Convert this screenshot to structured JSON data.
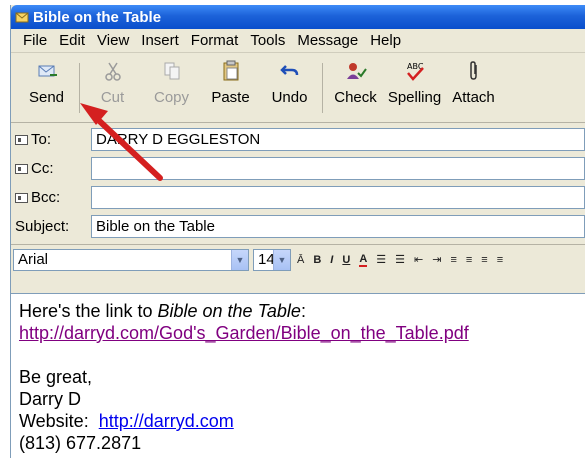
{
  "window": {
    "title": "Bible on the Table"
  },
  "menu": [
    "File",
    "Edit",
    "View",
    "Insert",
    "Format",
    "Tools",
    "Message",
    "Help"
  ],
  "toolbar": [
    {
      "label": "Send",
      "icon": "send-icon",
      "enabled": true
    },
    {
      "label": "Cut",
      "icon": "scissors-icon",
      "enabled": false
    },
    {
      "label": "Copy",
      "icon": "copy-icon",
      "enabled": false
    },
    {
      "label": "Paste",
      "icon": "paste-icon",
      "enabled": true
    },
    {
      "label": "Undo",
      "icon": "undo-icon",
      "enabled": true
    },
    {
      "label": "Check",
      "icon": "check-names-icon",
      "enabled": true
    },
    {
      "label": "Spelling",
      "icon": "spelling-icon",
      "enabled": true
    },
    {
      "label": "Attach",
      "icon": "paperclip-icon",
      "enabled": true
    }
  ],
  "header": {
    "to_label": "To:",
    "to_value": "DARRY D EGGLESTON",
    "cc_label": "Cc:",
    "cc_value": "",
    "bcc_label": "Bcc:",
    "bcc_value": "",
    "subject_label": "Subject:",
    "subject_value": "Bible on the Table"
  },
  "format": {
    "font": "Arial",
    "size": "14"
  },
  "body": {
    "intro_prefix": "Here's the link to ",
    "intro_title": "Bible on the Table",
    "intro_suffix": ":",
    "link1": "http://darryd.com/God's_Garden/Bible_on_the_Table.pdf",
    "sign1": "Be great,",
    "sign2": "Darry D",
    "website_label": "Website:  ",
    "website_link": "http://darryd.com",
    "phone": "(813) 677.2871"
  },
  "colors": {
    "title_bar": "#0a4fcc",
    "link": "#0000ee",
    "visited_link": "#800080",
    "arrow": "#d42020"
  }
}
